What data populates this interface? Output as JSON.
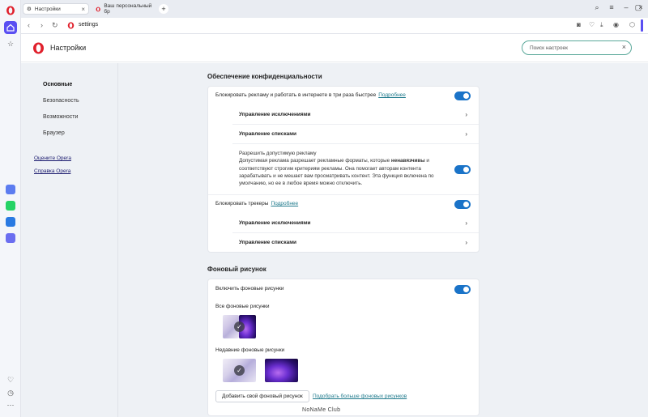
{
  "tabs": [
    {
      "label": "Настройки"
    },
    {
      "label": "Ваш персональный бр"
    }
  ],
  "address": {
    "url": "settings"
  },
  "settings": {
    "title": "Настройки",
    "search_placeholder": "Поиск настроек"
  },
  "leftnav": {
    "items": [
      "Основные",
      "Безопасность",
      "Возможности",
      "Браузер"
    ],
    "links": [
      "Оцените Opera",
      "Справка Opera"
    ]
  },
  "privacy": {
    "title": "Обеспечение конфиденциальности",
    "block_ads": "Блокировать рекламу и работать в интернете в три раза быстрее",
    "more": "Подробнее",
    "manage_exceptions": "Управление исключениями",
    "manage_lists": "Управление списками",
    "allow_ads_title": "Разрешить допустимую рекламу",
    "allow_ads_p1": "Допустимая реклама разрешает рекламные форматы, которые ",
    "allow_ads_bold": "ненавязчивы",
    "allow_ads_p2": " и соответствуют строгим критериям рекламы. Она помогает авторам контента зарабатывать и не мешает вам просматривать контент. Эта функция включена по умолчанию, но ее в любое время можно отключить.",
    "block_trackers": "Блокировать трекеры",
    "toggles": {
      "block_ads": true,
      "allow_ads": true,
      "block_trackers": true
    }
  },
  "wallpaper": {
    "title": "Фоновый рисунок",
    "enable": "Включить фоновые рисунки",
    "all": "Все фоновые рисунки",
    "recent": "Недавние фоновые рисунки",
    "add_button": "Добавить свой фоновый рисунок",
    "more_link": "Подобрать больше фоновых рисунков",
    "toggles": {
      "enable": true
    }
  },
  "watermark": "NoNaMe Club",
  "colors": {
    "accent": "#5a4ff2",
    "toggle_on": "#1a73c8",
    "link": "#1f7a8c"
  }
}
